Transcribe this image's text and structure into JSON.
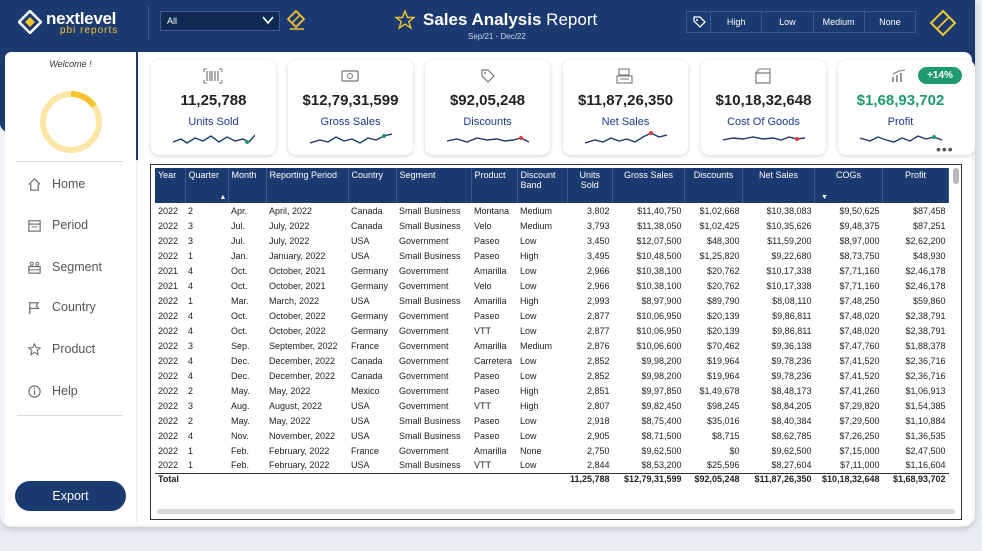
{
  "brand": {
    "name": "nextlevel",
    "sub": "pbi reports"
  },
  "filter": {
    "selected": "All"
  },
  "title": {
    "bold": "Sales Analysis",
    "rest": " Report",
    "period": "Sep/21 - Dec/22"
  },
  "priority": [
    "High",
    "Low",
    "Medium",
    "None"
  ],
  "sidebar": {
    "welcome": "Welcome !",
    "items": [
      {
        "label": "Home",
        "icon": "home-icon"
      },
      {
        "label": "Period",
        "icon": "calendar-icon"
      },
      {
        "label": "Segment",
        "icon": "segment-icon"
      },
      {
        "label": "Country",
        "icon": "flag-icon"
      },
      {
        "label": "Product",
        "icon": "product-icon"
      },
      {
        "label": "Help",
        "icon": "info-icon"
      }
    ],
    "export_label": "Export"
  },
  "cards": [
    {
      "value": "11,25,788",
      "label": "Units Sold",
      "icon": "barcode-icon"
    },
    {
      "value": "$12,79,31,599",
      "label": "Gross Sales",
      "icon": "money-icon"
    },
    {
      "value": "$92,05,248",
      "label": "Discounts",
      "icon": "tag-icon"
    },
    {
      "value": "$11,87,26,350",
      "label": "Net Sales",
      "icon": "register-icon"
    },
    {
      "value": "$10,18,32,648",
      "label": "Cost Of Goods",
      "icon": "box-icon"
    },
    {
      "value": "$1,68,93,702",
      "label": "Profit",
      "icon": "growth-icon",
      "badge": "+14%"
    }
  ],
  "colors": {
    "navy": "#1b3a6f",
    "accent": "#f4c430",
    "green": "#1e9a6e",
    "marker": "#e53935"
  },
  "table": {
    "columns": [
      "Year",
      "Quarter",
      "Month",
      "Reporting Period",
      "Country",
      "Segment",
      "Product",
      "Discount Band",
      "Units Sold",
      "Gross Sales",
      "Discounts",
      "Net Sales",
      "COGs",
      "Profit"
    ],
    "rows": [
      [
        "2022",
        "2",
        "Apr.",
        "April, 2022",
        "Canada",
        "Small Business",
        "Montana",
        "Medium",
        "3,802",
        "$11,40,750",
        "$1,02,668",
        "$10,38,083",
        "$9,50,625",
        "$87,458"
      ],
      [
        "2022",
        "3",
        "Jul.",
        "July, 2022",
        "Canada",
        "Small Business",
        "Velo",
        "Medium",
        "3,793",
        "$11,38,050",
        "$1,02,425",
        "$10,35,626",
        "$9,48,375",
        "$87,251"
      ],
      [
        "2022",
        "3",
        "Jul.",
        "July, 2022",
        "USA",
        "Government",
        "Paseo",
        "Low",
        "3,450",
        "$12,07,500",
        "$48,300",
        "$11,59,200",
        "$8,97,000",
        "$2,62,200"
      ],
      [
        "2022",
        "1",
        "Jan.",
        "January, 2022",
        "USA",
        "Small Business",
        "Paseo",
        "High",
        "3,495",
        "$10,48,500",
        "$1,25,820",
        "$9,22,680",
        "$8,73,750",
        "$48,930"
      ],
      [
        "2021",
        "4",
        "Oct.",
        "October, 2021",
        "Germany",
        "Government",
        "Amarilla",
        "Low",
        "2,966",
        "$10,38,100",
        "$20,762",
        "$10,17,338",
        "$7,71,160",
        "$2,46,178"
      ],
      [
        "2021",
        "4",
        "Oct.",
        "October, 2021",
        "Germany",
        "Government",
        "Velo",
        "Low",
        "2,966",
        "$10,38,100",
        "$20,762",
        "$10,17,338",
        "$7,71,160",
        "$2,46,178"
      ],
      [
        "2022",
        "1",
        "Mar.",
        "March, 2022",
        "USA",
        "Small Business",
        "Amarilla",
        "High",
        "2,993",
        "$8,97,900",
        "$89,790",
        "$8,08,110",
        "$7,48,250",
        "$59,860"
      ],
      [
        "2022",
        "4",
        "Oct.",
        "October, 2022",
        "Germany",
        "Government",
        "Paseo",
        "Low",
        "2,877",
        "$10,06,950",
        "$20,139",
        "$9,86,811",
        "$7,48,020",
        "$2,38,791"
      ],
      [
        "2022",
        "4",
        "Oct.",
        "October, 2022",
        "Germany",
        "Government",
        "VTT",
        "Low",
        "2,877",
        "$10,06,950",
        "$20,139",
        "$9,86,811",
        "$7,48,020",
        "$2,38,791"
      ],
      [
        "2022",
        "3",
        "Sep.",
        "September, 2022",
        "France",
        "Government",
        "Amarilla",
        "Medium",
        "2,876",
        "$10,06,600",
        "$70,462",
        "$9,36,138",
        "$7,47,760",
        "$1,88,378"
      ],
      [
        "2022",
        "4",
        "Dec.",
        "December, 2022",
        "Canada",
        "Government",
        "Carretera",
        "Low",
        "2,852",
        "$9,98,200",
        "$19,964",
        "$9,78,236",
        "$7,41,520",
        "$2,36,716"
      ],
      [
        "2022",
        "4",
        "Dec.",
        "December, 2022",
        "Canada",
        "Government",
        "Paseo",
        "Low",
        "2,852",
        "$9,98,200",
        "$19,964",
        "$9,78,236",
        "$7,41,520",
        "$2,36,716"
      ],
      [
        "2022",
        "2",
        "May.",
        "May, 2022",
        "Mexico",
        "Government",
        "Paseo",
        "High",
        "2,851",
        "$9,97,850",
        "$1,49,678",
        "$8,48,173",
        "$7,41,260",
        "$1,06,913"
      ],
      [
        "2022",
        "3",
        "Aug.",
        "August, 2022",
        "USA",
        "Government",
        "VTT",
        "High",
        "2,807",
        "$9,82,450",
        "$98,245",
        "$8,84,205",
        "$7,29,820",
        "$1,54,385"
      ],
      [
        "2022",
        "2",
        "May.",
        "May, 2022",
        "USA",
        "Small Business",
        "Paseo",
        "Low",
        "2,918",
        "$8,75,400",
        "$35,016",
        "$8,40,384",
        "$7,29,500",
        "$1,10,884"
      ],
      [
        "2022",
        "4",
        "Nov.",
        "November, 2022",
        "USA",
        "Small Business",
        "Paseo",
        "Low",
        "2,905",
        "$8,71,500",
        "$8,715",
        "$8,62,785",
        "$7,26,250",
        "$1,36,535"
      ],
      [
        "2022",
        "1",
        "Feb.",
        "February, 2022",
        "France",
        "Government",
        "Amarilla",
        "None",
        "2,750",
        "$9,62,500",
        "$0",
        "$9,62,500",
        "$7,15,000",
        "$2,47,500"
      ],
      [
        "2022",
        "1",
        "Feb.",
        "February, 2022",
        "USA",
        "Small Business",
        "VTT",
        "Low",
        "2,844",
        "$8,53,200",
        "$25,596",
        "$8,27,604",
        "$7,11,000",
        "$1,16,604"
      ]
    ],
    "total": {
      "label": "Total",
      "units": "11,25,788",
      "gross": "$12,79,31,599",
      "discounts": "$92,05,248",
      "net": "$11,87,26,350",
      "cogs": "$10,18,32,648",
      "profit": "$1,68,93,702"
    }
  }
}
